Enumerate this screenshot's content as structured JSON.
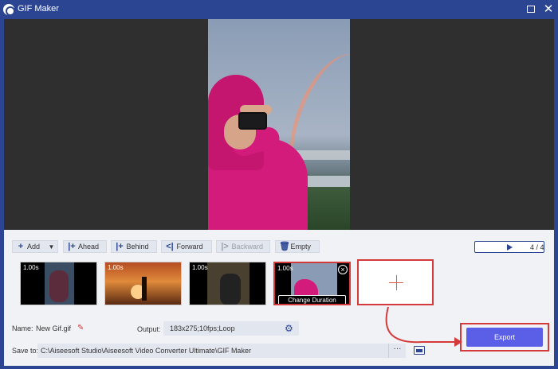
{
  "window": {
    "title": "GIF Maker"
  },
  "toolbar": {
    "add": "Add",
    "ahead": "Ahead",
    "behind": "Behind",
    "forward": "Forward",
    "backward": "Backward",
    "empty": "Empty"
  },
  "player": {
    "counter": "4 / 4"
  },
  "thumbnails": [
    {
      "duration": "1.00s"
    },
    {
      "duration": "1.00s"
    },
    {
      "duration": "1.00s"
    },
    {
      "duration": "1.00s",
      "selected": true,
      "action": "Change Duration"
    }
  ],
  "settings": {
    "name_label": "Name:",
    "name_value": "New Gif.gif",
    "output_label": "Output:",
    "output_value": "183x275;10fps;Loop",
    "save_label": "Save to:",
    "save_path": "C:\\Aiseesoft Studio\\Aiseesoft Video Converter Ultimate\\GIF Maker",
    "browse": "···"
  },
  "export": {
    "label": "Export"
  },
  "colors": {
    "accent": "#2b4592",
    "export": "#5b5ee6",
    "highlight": "#d43a3a"
  }
}
